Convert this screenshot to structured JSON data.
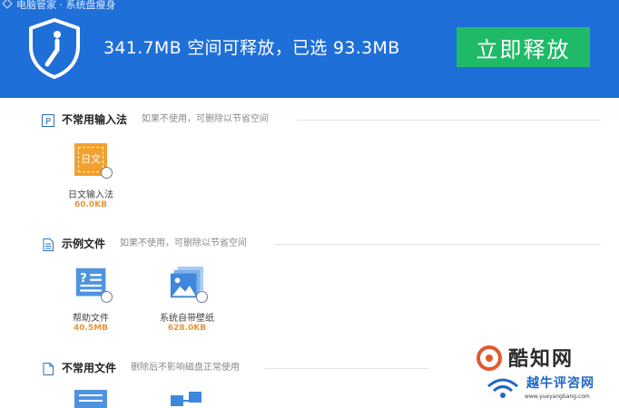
{
  "header": {
    "tab_text": "电脑管家 · 系统盘瘦身",
    "headline": "341.7MB 空间可释放，已选 93.3MB",
    "release_button": "立即释放",
    "colors": {
      "background": "#1f6fd8",
      "button": "#1fba67"
    }
  },
  "sections": [
    {
      "title": "不常用输入法",
      "desc": "如果不使用，可删除以节省空间",
      "icon": "input-method-section-icon",
      "items": [
        {
          "name": "日文输入法",
          "size": "60.0KB",
          "icon_text": "日文",
          "icon": "japanese-ime-icon"
        }
      ]
    },
    {
      "title": "示例文件",
      "desc": "如果不使用，可删除以节省空间",
      "icon": "document-section-icon",
      "items": [
        {
          "name": "帮助文件",
          "size": "40.5MB",
          "icon": "help-file-icon"
        },
        {
          "name": "系统自带壁纸",
          "size": "628.0KB",
          "icon": "wallpaper-icon"
        }
      ]
    },
    {
      "title": "不常用文件",
      "desc": "删除后不影响磁盘正常使用",
      "icon": "file-section-icon",
      "items": []
    }
  ],
  "watermark": {
    "brand1": "酷知网",
    "brand2": "越牛评咨网",
    "url": "www.yueyangbang.com"
  }
}
